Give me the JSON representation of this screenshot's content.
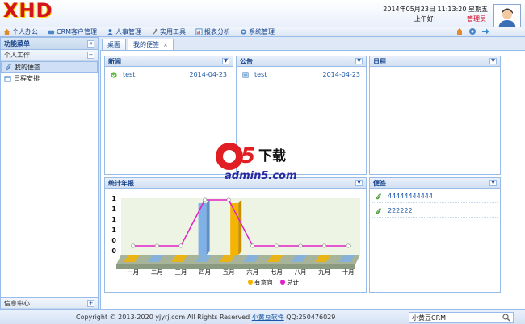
{
  "brand": {
    "logo": "XHD"
  },
  "header": {
    "datetime": "2014年05月23日 11:13:20 星期五",
    "greeting": "上午好!",
    "role": "管理员"
  },
  "menu": [
    {
      "label": "个人办公",
      "icon": "home-icon"
    },
    {
      "label": "CRM客户管理",
      "icon": "crm-icon"
    },
    {
      "label": "人事管理",
      "icon": "user-icon"
    },
    {
      "label": "实用工具",
      "icon": "tools-icon"
    },
    {
      "label": "报表分析",
      "icon": "report-icon"
    },
    {
      "label": "系统管理",
      "icon": "gear-icon"
    }
  ],
  "sidebar": {
    "title": "功能菜单",
    "group": "个人工作",
    "items": [
      {
        "label": "我的便签",
        "active": true
      },
      {
        "label": "日程安排",
        "active": false
      }
    ],
    "bottom": "信息中心"
  },
  "tabs": [
    {
      "label": "桌面",
      "active": false
    },
    {
      "label": "我的便签",
      "active": true,
      "closable": true
    }
  ],
  "news": {
    "title": "新闻",
    "rows": [
      {
        "text": "test",
        "date": "2014-04-23"
      }
    ]
  },
  "notice": {
    "title": "公告",
    "rows": [
      {
        "text": "test",
        "date": "2014-04-23"
      }
    ]
  },
  "schedule": {
    "title": "日程"
  },
  "stats": {
    "title": "统计年报"
  },
  "memo": {
    "title": "便签",
    "rows": [
      "44444444444",
      "222222"
    ]
  },
  "watermark": {
    "brand": "a5下载",
    "site": "admin5.com"
  },
  "chart_data": {
    "type": "bar",
    "categories": [
      "一月",
      "二月",
      "三月",
      "四月",
      "五月",
      "六月",
      "七月",
      "八月",
      "九月",
      "十月"
    ],
    "y_ticks": [
      "1",
      "1",
      "1",
      "1",
      "0",
      "0"
    ],
    "series": [
      {
        "name": "有意向",
        "type": "bar",
        "color": "#f5b400",
        "values": [
          0,
          0,
          0,
          0,
          1,
          0,
          0,
          0,
          0,
          0
        ]
      },
      {
        "name": "总计",
        "type": "line",
        "color": "#e020c8",
        "values": [
          0,
          0,
          0,
          1,
          1,
          0,
          0,
          0,
          0,
          0
        ]
      }
    ],
    "extra_bar": {
      "color": "#7fb0e6",
      "values": [
        0,
        0,
        0,
        1,
        0,
        0,
        0,
        0,
        0,
        0
      ]
    },
    "ylim": [
      0,
      1
    ]
  },
  "footer": {
    "copyright": "Copyright © 2013-2020 yjyrj.com All Rights Reserved ",
    "brand_link": "小黄豆软件",
    "qq": " QQ:250476029",
    "search_value": "小黄豆CRM"
  }
}
